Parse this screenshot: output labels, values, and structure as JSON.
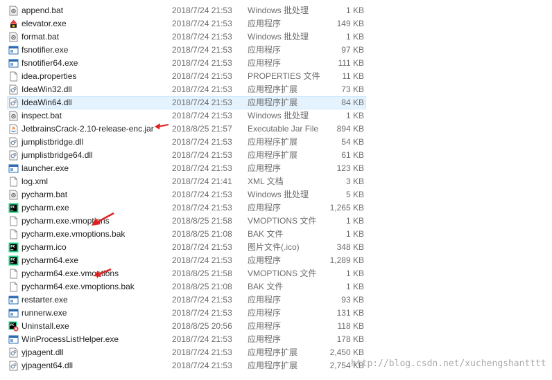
{
  "files": [
    {
      "name": "append.bat",
      "date": "2018/7/24 21:53",
      "type": "Windows 批处理",
      "size": "1 KB",
      "icon": "bat-gear-icon"
    },
    {
      "name": "elevator.exe",
      "date": "2018/7/24 21:53",
      "type": "应用程序",
      "size": "149 KB",
      "icon": "elevator-exe-icon"
    },
    {
      "name": "format.bat",
      "date": "2018/7/24 21:53",
      "type": "Windows 批处理",
      "size": "1 KB",
      "icon": "bat-gear-icon"
    },
    {
      "name": "fsnotifier.exe",
      "date": "2018/7/24 21:53",
      "type": "应用程序",
      "size": "97 KB",
      "icon": "exe-window-icon"
    },
    {
      "name": "fsnotifier64.exe",
      "date": "2018/7/24 21:53",
      "type": "应用程序",
      "size": "111 KB",
      "icon": "exe-window-icon"
    },
    {
      "name": "idea.properties",
      "date": "2018/7/24 21:53",
      "type": "PROPERTIES 文件",
      "size": "11 KB",
      "icon": "blank-file-icon"
    },
    {
      "name": "IdeaWin32.dll",
      "date": "2018/7/24 21:53",
      "type": "应用程序扩展",
      "size": "73 KB",
      "icon": "dll-gear-icon"
    },
    {
      "name": "IdeaWin64.dll",
      "date": "2018/7/24 21:53",
      "type": "应用程序扩展",
      "size": "84 KB",
      "icon": "dll-gear-icon",
      "selected": true
    },
    {
      "name": "inspect.bat",
      "date": "2018/7/24 21:53",
      "type": "Windows 批处理",
      "size": "1 KB",
      "icon": "bat-gear-icon"
    },
    {
      "name": "JetbrainsCrack-2.10-release-enc.jar",
      "date": "2018/8/25 21:57",
      "type": "Executable Jar File",
      "size": "894 KB",
      "icon": "java-jar-icon"
    },
    {
      "name": "jumplistbridge.dll",
      "date": "2018/7/24 21:53",
      "type": "应用程序扩展",
      "size": "54 KB",
      "icon": "dll-gear-icon"
    },
    {
      "name": "jumplistbridge64.dll",
      "date": "2018/7/24 21:53",
      "type": "应用程序扩展",
      "size": "61 KB",
      "icon": "dll-gear-icon"
    },
    {
      "name": "launcher.exe",
      "date": "2018/7/24 21:53",
      "type": "应用程序",
      "size": "123 KB",
      "icon": "exe-window-icon"
    },
    {
      "name": "log.xml",
      "date": "2018/7/24 21:41",
      "type": "XML 文档",
      "size": "3 KB",
      "icon": "blank-file-icon"
    },
    {
      "name": "pycharm.bat",
      "date": "2018/7/24 21:53",
      "type": "Windows 批处理",
      "size": "5 KB",
      "icon": "bat-gear-icon"
    },
    {
      "name": "pycharm.exe",
      "date": "2018/7/24 21:53",
      "type": "应用程序",
      "size": "1,265 KB",
      "icon": "pycharm-icon"
    },
    {
      "name": "pycharm.exe.vmoptions",
      "date": "2018/8/25 21:58",
      "type": "VMOPTIONS 文件",
      "size": "1 KB",
      "icon": "blank-file-icon"
    },
    {
      "name": "pycharm.exe.vmoptions.bak",
      "date": "2018/8/25 21:08",
      "type": "BAK 文件",
      "size": "1 KB",
      "icon": "blank-file-icon"
    },
    {
      "name": "pycharm.ico",
      "date": "2018/7/24 21:53",
      "type": "图片文件(.ico)",
      "size": "348 KB",
      "icon": "pycharm-icon"
    },
    {
      "name": "pycharm64.exe",
      "date": "2018/7/24 21:53",
      "type": "应用程序",
      "size": "1,289 KB",
      "icon": "pycharm-icon"
    },
    {
      "name": "pycharm64.exe.vmoptions",
      "date": "2018/8/25 21:58",
      "type": "VMOPTIONS 文件",
      "size": "1 KB",
      "icon": "blank-file-icon"
    },
    {
      "name": "pycharm64.exe.vmoptions.bak",
      "date": "2018/8/25 21:08",
      "type": "BAK 文件",
      "size": "1 KB",
      "icon": "blank-file-icon"
    },
    {
      "name": "restarter.exe",
      "date": "2018/7/24 21:53",
      "type": "应用程序",
      "size": "93 KB",
      "icon": "exe-window-icon"
    },
    {
      "name": "runnerw.exe",
      "date": "2018/7/24 21:53",
      "type": "应用程序",
      "size": "131 KB",
      "icon": "exe-window-icon"
    },
    {
      "name": "Uninstall.exe",
      "date": "2018/8/25 20:56",
      "type": "应用程序",
      "size": "118 KB",
      "icon": "pycharm-uninstall-icon"
    },
    {
      "name": "WinProcessListHelper.exe",
      "date": "2018/7/24 21:53",
      "type": "应用程序",
      "size": "178 KB",
      "icon": "exe-window-icon"
    },
    {
      "name": "yjpagent.dll",
      "date": "2018/7/24 21:53",
      "type": "应用程序扩展",
      "size": "2,450 KB",
      "icon": "dll-gear-icon"
    },
    {
      "name": "yjpagent64.dll",
      "date": "2018/7/24 21:53",
      "type": "应用程序扩展",
      "size": "2,754 KB",
      "icon": "dll-gear-icon"
    }
  ],
  "watermark": "http://blog.csdn.net/xuchengshantttt",
  "colors": {
    "selection_bg": "#e5f3ff",
    "selection_border": "#cde8ff",
    "meta_text": "#6d6d6d",
    "annotation_arrow": "#e02020"
  }
}
